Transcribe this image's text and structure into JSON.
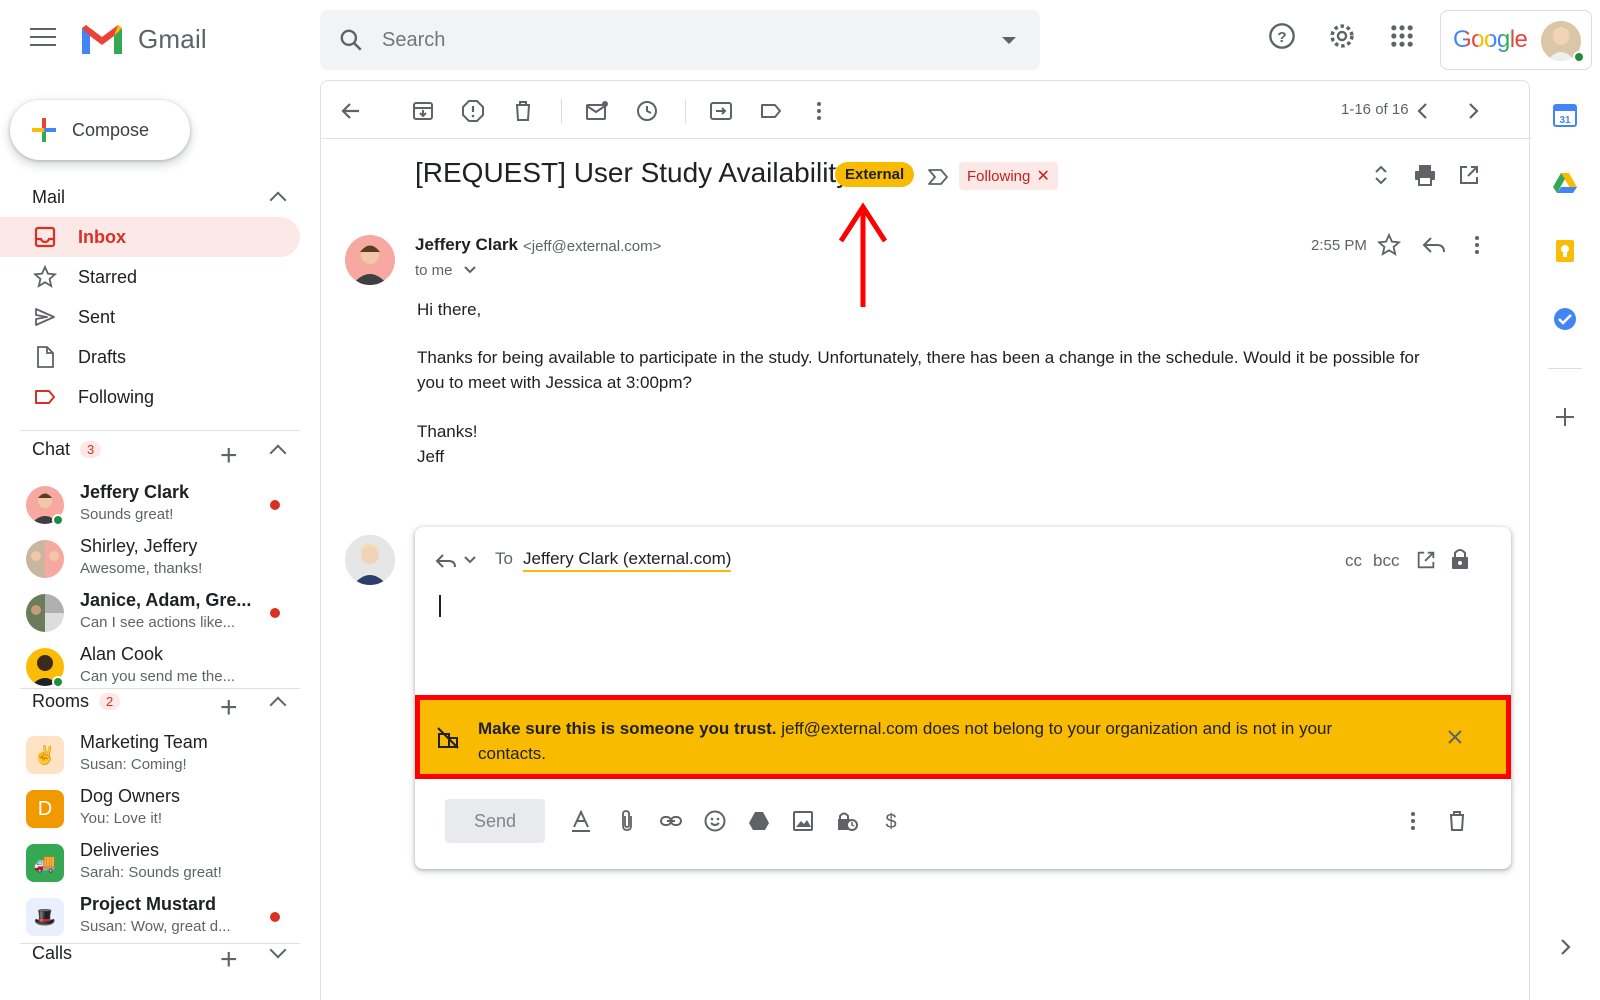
{
  "app": {
    "name": "Gmail",
    "google_word": "Google"
  },
  "search": {
    "placeholder": "Search"
  },
  "compose": {
    "label": "Compose"
  },
  "mail_section": {
    "title": "Mail"
  },
  "nav": [
    {
      "label": "Inbox",
      "icon": "inbox-icon",
      "active": true
    },
    {
      "label": "Starred",
      "icon": "star-icon"
    },
    {
      "label": "Sent",
      "icon": "send-icon"
    },
    {
      "label": "Drafts",
      "icon": "draft-icon"
    },
    {
      "label": "Following",
      "icon": "label-icon"
    }
  ],
  "chat_section": {
    "title": "Chat",
    "badge": "3"
  },
  "chats": [
    {
      "name": "Jeffery Clark",
      "preview": "Sounds great!",
      "unread": true,
      "bold": true
    },
    {
      "name": "Shirley, Jeffery",
      "preview": "Awesome, thanks!",
      "unread": false,
      "bold": false
    },
    {
      "name": "Janice, Adam, Gre...",
      "preview": "Can I see actions like...",
      "unread": true,
      "bold": true
    },
    {
      "name": "Alan Cook",
      "preview": "Can you send me the...",
      "unread": false,
      "bold": false
    }
  ],
  "rooms_section": {
    "title": "Rooms",
    "badge": "2"
  },
  "rooms": [
    {
      "name": "Marketing Team",
      "preview": "Susan: Coming!",
      "bold": false
    },
    {
      "name": "Dog Owners",
      "preview": "You: Love it!",
      "avatar_letter": "D",
      "bold": false
    },
    {
      "name": "Deliveries",
      "preview": "Sarah: Sounds great!",
      "bold": false
    },
    {
      "name": "Project Mustard",
      "preview": "Susan: Wow, great d...",
      "bold": true,
      "unread": true
    }
  ],
  "calls_section": {
    "title": "Calls"
  },
  "toolbar": {
    "pager": "1-16 of 16"
  },
  "email": {
    "subject": "[REQUEST] User Study Availability",
    "external_label": "External",
    "following_label": "Following",
    "sender_name": "Jeffery Clark",
    "sender_email": "<jeff@external.com>",
    "recipient": "to me",
    "time": "2:55 PM",
    "greeting": "Hi there,",
    "paragraph_line1": "Thanks for being available to participate in the study. Unfortunately, there has been a change in the schedule. Would it be possible for",
    "paragraph_line2": "you to meet with Jessica at 3:00pm?",
    "signoff": "Thanks!",
    "signature": "Jeff"
  },
  "reply": {
    "to_label": "To",
    "to_value": "Jeffery Clark (external.com)",
    "cc": "cc",
    "bcc": "bcc",
    "warning_bold": "Make sure this is someone you trust.",
    "warning_rest": " jeff@external.com does not belong to your organization and is not in your contacts.",
    "send_label": "Send"
  },
  "colors": {
    "accent_red": "#d93025",
    "external_yellow": "#f9bb00",
    "annotation_red": "#ff0000"
  }
}
